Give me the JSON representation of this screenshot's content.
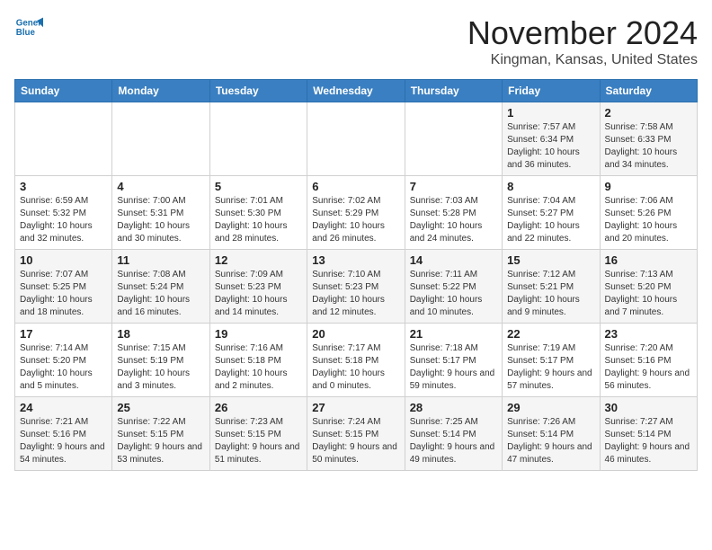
{
  "header": {
    "logo_line1": "General",
    "logo_line2": "Blue",
    "month": "November 2024",
    "location": "Kingman, Kansas, United States"
  },
  "weekdays": [
    "Sunday",
    "Monday",
    "Tuesday",
    "Wednesday",
    "Thursday",
    "Friday",
    "Saturday"
  ],
  "weeks": [
    [
      {
        "day": "",
        "info": ""
      },
      {
        "day": "",
        "info": ""
      },
      {
        "day": "",
        "info": ""
      },
      {
        "day": "",
        "info": ""
      },
      {
        "day": "",
        "info": ""
      },
      {
        "day": "1",
        "info": "Sunrise: 7:57 AM\nSunset: 6:34 PM\nDaylight: 10 hours and 36 minutes."
      },
      {
        "day": "2",
        "info": "Sunrise: 7:58 AM\nSunset: 6:33 PM\nDaylight: 10 hours and 34 minutes."
      }
    ],
    [
      {
        "day": "3",
        "info": "Sunrise: 6:59 AM\nSunset: 5:32 PM\nDaylight: 10 hours and 32 minutes."
      },
      {
        "day": "4",
        "info": "Sunrise: 7:00 AM\nSunset: 5:31 PM\nDaylight: 10 hours and 30 minutes."
      },
      {
        "day": "5",
        "info": "Sunrise: 7:01 AM\nSunset: 5:30 PM\nDaylight: 10 hours and 28 minutes."
      },
      {
        "day": "6",
        "info": "Sunrise: 7:02 AM\nSunset: 5:29 PM\nDaylight: 10 hours and 26 minutes."
      },
      {
        "day": "7",
        "info": "Sunrise: 7:03 AM\nSunset: 5:28 PM\nDaylight: 10 hours and 24 minutes."
      },
      {
        "day": "8",
        "info": "Sunrise: 7:04 AM\nSunset: 5:27 PM\nDaylight: 10 hours and 22 minutes."
      },
      {
        "day": "9",
        "info": "Sunrise: 7:06 AM\nSunset: 5:26 PM\nDaylight: 10 hours and 20 minutes."
      }
    ],
    [
      {
        "day": "10",
        "info": "Sunrise: 7:07 AM\nSunset: 5:25 PM\nDaylight: 10 hours and 18 minutes."
      },
      {
        "day": "11",
        "info": "Sunrise: 7:08 AM\nSunset: 5:24 PM\nDaylight: 10 hours and 16 minutes."
      },
      {
        "day": "12",
        "info": "Sunrise: 7:09 AM\nSunset: 5:23 PM\nDaylight: 10 hours and 14 minutes."
      },
      {
        "day": "13",
        "info": "Sunrise: 7:10 AM\nSunset: 5:23 PM\nDaylight: 10 hours and 12 minutes."
      },
      {
        "day": "14",
        "info": "Sunrise: 7:11 AM\nSunset: 5:22 PM\nDaylight: 10 hours and 10 minutes."
      },
      {
        "day": "15",
        "info": "Sunrise: 7:12 AM\nSunset: 5:21 PM\nDaylight: 10 hours and 9 minutes."
      },
      {
        "day": "16",
        "info": "Sunrise: 7:13 AM\nSunset: 5:20 PM\nDaylight: 10 hours and 7 minutes."
      }
    ],
    [
      {
        "day": "17",
        "info": "Sunrise: 7:14 AM\nSunset: 5:20 PM\nDaylight: 10 hours and 5 minutes."
      },
      {
        "day": "18",
        "info": "Sunrise: 7:15 AM\nSunset: 5:19 PM\nDaylight: 10 hours and 3 minutes."
      },
      {
        "day": "19",
        "info": "Sunrise: 7:16 AM\nSunset: 5:18 PM\nDaylight: 10 hours and 2 minutes."
      },
      {
        "day": "20",
        "info": "Sunrise: 7:17 AM\nSunset: 5:18 PM\nDaylight: 10 hours and 0 minutes."
      },
      {
        "day": "21",
        "info": "Sunrise: 7:18 AM\nSunset: 5:17 PM\nDaylight: 9 hours and 59 minutes."
      },
      {
        "day": "22",
        "info": "Sunrise: 7:19 AM\nSunset: 5:17 PM\nDaylight: 9 hours and 57 minutes."
      },
      {
        "day": "23",
        "info": "Sunrise: 7:20 AM\nSunset: 5:16 PM\nDaylight: 9 hours and 56 minutes."
      }
    ],
    [
      {
        "day": "24",
        "info": "Sunrise: 7:21 AM\nSunset: 5:16 PM\nDaylight: 9 hours and 54 minutes."
      },
      {
        "day": "25",
        "info": "Sunrise: 7:22 AM\nSunset: 5:15 PM\nDaylight: 9 hours and 53 minutes."
      },
      {
        "day": "26",
        "info": "Sunrise: 7:23 AM\nSunset: 5:15 PM\nDaylight: 9 hours and 51 minutes."
      },
      {
        "day": "27",
        "info": "Sunrise: 7:24 AM\nSunset: 5:15 PM\nDaylight: 9 hours and 50 minutes."
      },
      {
        "day": "28",
        "info": "Sunrise: 7:25 AM\nSunset: 5:14 PM\nDaylight: 9 hours and 49 minutes."
      },
      {
        "day": "29",
        "info": "Sunrise: 7:26 AM\nSunset: 5:14 PM\nDaylight: 9 hours and 47 minutes."
      },
      {
        "day": "30",
        "info": "Sunrise: 7:27 AM\nSunset: 5:14 PM\nDaylight: 9 hours and 46 minutes."
      }
    ]
  ]
}
